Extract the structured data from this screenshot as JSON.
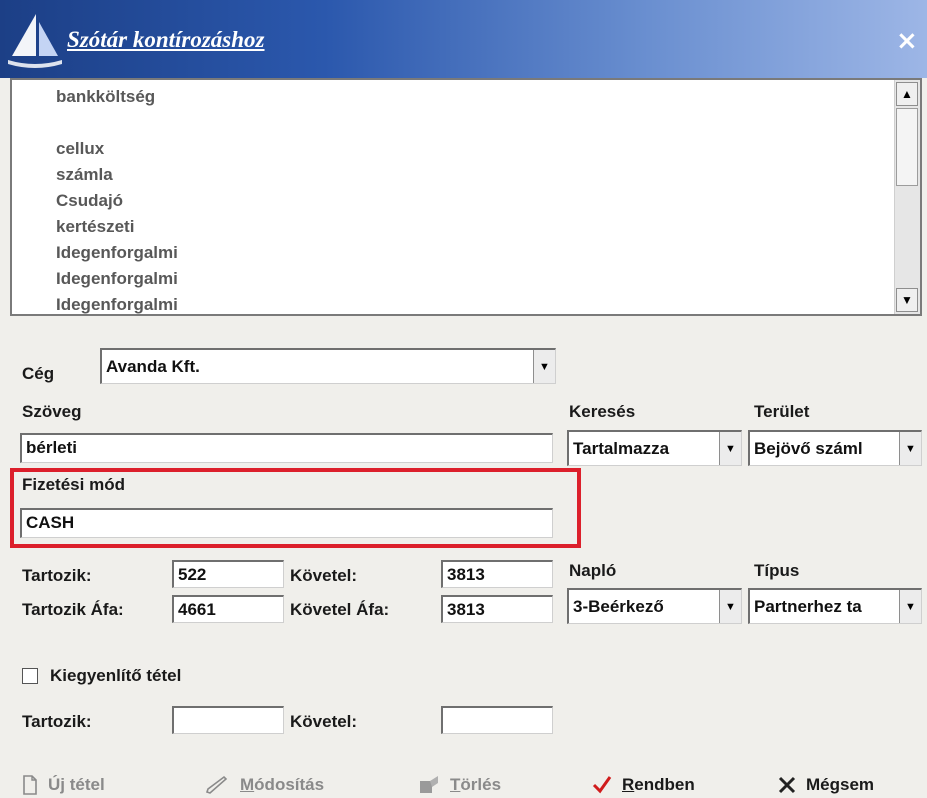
{
  "window": {
    "title": "Szótár kontírozáshoz",
    "close": "×"
  },
  "list": {
    "items": [
      "bankköltség",
      "",
      "cellux",
      "számla",
      "Csudajó",
      "kertészeti",
      "Idegenforgalmi",
      "Idegenforgalmi",
      "Idegenforgalmi"
    ]
  },
  "ceg": {
    "label": "Cég",
    "value": "Avanda Kft."
  },
  "szoveg": {
    "label": "Szöveg",
    "value": "bérleti"
  },
  "kereses": {
    "label": "Keresés",
    "value": "Tartalmazza"
  },
  "terulet": {
    "label": "Terület",
    "value": "Bejövő száml"
  },
  "fizetesi_mod": {
    "label": "Fizetési mód",
    "value": "CASH"
  },
  "tartozik": {
    "label": "Tartozik:",
    "value": "522"
  },
  "kovetel": {
    "label": "Követel:",
    "value": "3813"
  },
  "tartozik_afa": {
    "label": "Tartozik Áfa:",
    "value": "4661"
  },
  "kovetel_afa": {
    "label": "Követel Áfa:",
    "value": "3813"
  },
  "naplo": {
    "label": "Napló",
    "value": "3-Beérkező"
  },
  "tipus": {
    "label": "Típus",
    "value": "Partnerhez ta"
  },
  "kiegyenlito": {
    "label": "Kiegyenlítő tétel",
    "checked": false,
    "tartozik_label": "Tartozik:",
    "tartozik_value": "",
    "kovetel_label": "Követel:",
    "kovetel_value": ""
  },
  "buttons": {
    "new": "Új tétel",
    "modify": "Módosítás",
    "delete": "Törlés",
    "ok": "Rendben",
    "cancel": "Mégsem"
  },
  "colors": {
    "highlight": "#dc1f2b",
    "ok_check": "#d01c1c",
    "cancel_x": "#222222"
  },
  "icons": {
    "logo": "sail-logo-icon",
    "close": "close-icon",
    "new": "document-icon",
    "modify": "pencil-icon",
    "delete": "eraser-icon",
    "ok": "check-icon",
    "cancel": "x-icon"
  }
}
